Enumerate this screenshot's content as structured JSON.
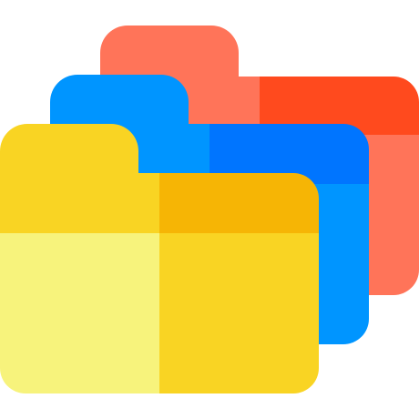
{
  "icon": {
    "name": "stacked-folders-icon",
    "folders": [
      {
        "name": "back-folder",
        "colors": {
          "tab": "#FF7459",
          "top_left": "#FF7459",
          "top_right": "#FF4A1E",
          "body_left": "#FF7459",
          "body_right": "#FF7459"
        }
      },
      {
        "name": "middle-folder",
        "colors": {
          "tab": "#0095FF",
          "top_left": "#0095FF",
          "top_right": "#0075FF",
          "body_left": "#0095FF",
          "body_right": "#0095FF"
        }
      },
      {
        "name": "front-folder",
        "colors": {
          "tab": "#F9D423",
          "top_left": "#F9D423",
          "top_right": "#F6B505",
          "body_left": "#F7F37C",
          "body_right": "#F9D423"
        }
      }
    ]
  }
}
